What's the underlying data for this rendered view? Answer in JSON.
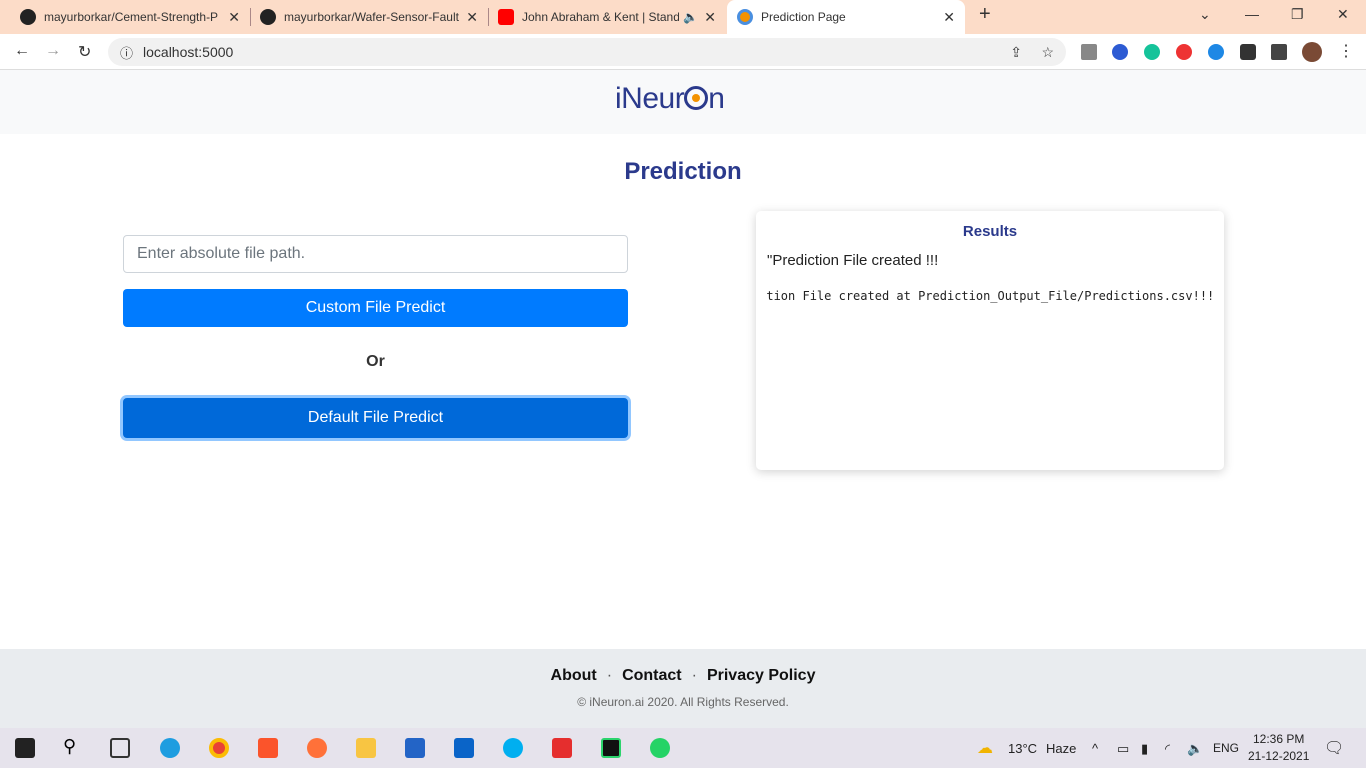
{
  "browser": {
    "tabs": [
      {
        "label": "mayurborkar/Cement-Strength-P",
        "icon": "github-icon"
      },
      {
        "label": "mayurborkar/Wafer-Sensor-Fault",
        "icon": "github-icon"
      },
      {
        "label": "John Abraham & Kent | Stand",
        "icon": "youtube-icon"
      },
      {
        "label": "Prediction Page",
        "icon": "ineuron-icon",
        "active": true
      }
    ],
    "url": "localhost:5000"
  },
  "header": {
    "logo": "iNeuron"
  },
  "page": {
    "title": "Prediction",
    "file_path_placeholder": "Enter absolute file path.",
    "custom_button": "Custom File Predict",
    "or": "Or",
    "default_button": "Default File Predict",
    "colors": {
      "primary": "#007bff",
      "active": "#0069d9",
      "title": "#2b3a8c"
    }
  },
  "results": {
    "title": "Results",
    "message": "\"Prediction File created !!!",
    "log": "Prediction File created at Prediction_Output_File/Predictions.csv!!!"
  },
  "footer": {
    "about": "About",
    "contact": "Contact",
    "privacy": "Privacy Policy",
    "separator": "·",
    "copyright": "© iNeuron.ai 2020. All Rights Reserved."
  },
  "taskbar": {
    "weather": "13°C",
    "condition": "Haze",
    "lang": "ENG",
    "time": "12:36 PM",
    "date": "21-12-2021"
  }
}
